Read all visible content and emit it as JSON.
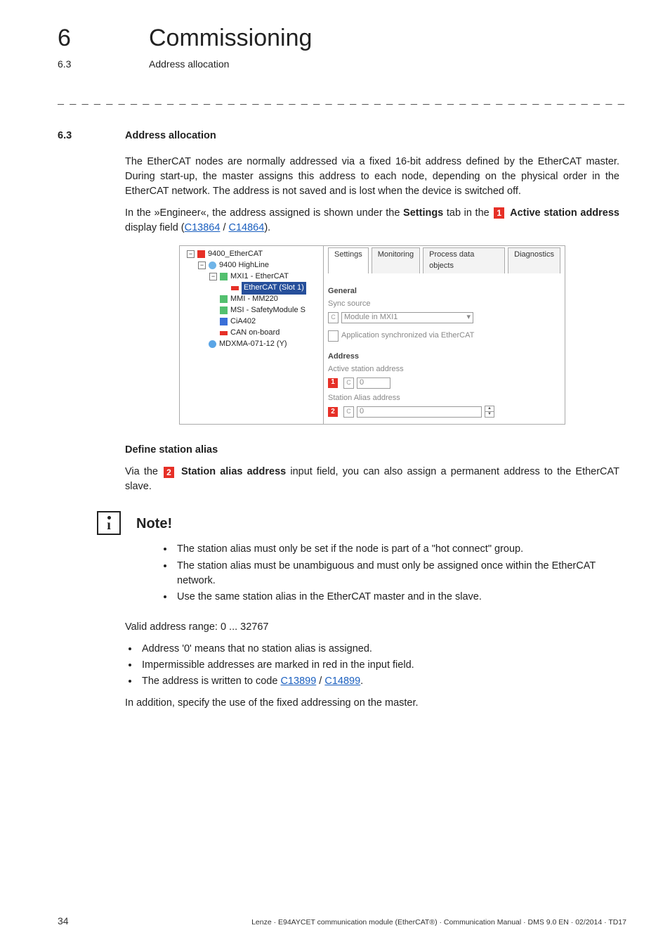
{
  "header": {
    "chapter_number": "6",
    "chapter_title": "Commissioning",
    "section_number": "6.3",
    "section_title_small": "Address allocation"
  },
  "ruler": "_ _ _ _ _ _ _ _ _ _ _ _ _ _ _ _ _ _ _ _ _ _ _ _ _ _ _ _ _ _ _ _ _ _ _ _ _ _ _ _ _ _ _ _ _ _ _ _ _ _ _ _ _ _ _ _ _ _ _ _ _ _ _ _",
  "section": {
    "number": "6.3",
    "title": "Address allocation"
  },
  "para1": "The EtherCAT nodes are normally addressed via a fixed 16-bit address defined by the EtherCAT master. During start-up, the master assigns this address to each node, depending on the physical order in the EtherCAT network. The address is not saved and is lost when the device is switched off.",
  "para2": {
    "a": "In the »Engineer«, the address assigned is shown under the ",
    "b_bold": "Settings",
    "c": " tab in the ",
    "marker": "1",
    "d_bold": " Active station address",
    "e": " display field (",
    "link1": "C13864",
    "sep": " / ",
    "link2": "C14864",
    "f": ")."
  },
  "figure": {
    "tree": [
      {
        "indent": 1,
        "exp": "−",
        "iconClass": "dev",
        "label": "9400_EtherCAT",
        "sel": false
      },
      {
        "indent": 2,
        "exp": "−",
        "iconClass": "sphere",
        "label": "9400 HighLine",
        "sel": false
      },
      {
        "indent": 3,
        "exp": "−",
        "iconClass": "chip",
        "label": "MXI1 - EtherCAT",
        "sel": false
      },
      {
        "indent": 4,
        "exp": "",
        "iconClass": "bar",
        "label": "EtherCAT (Slot 1)",
        "sel": true
      },
      {
        "indent": 3,
        "exp": "",
        "iconClass": "chip",
        "label": "MMI - MM220",
        "sel": false
      },
      {
        "indent": 3,
        "exp": "",
        "iconClass": "chip",
        "label": "MSI - SafetyModule S",
        "sel": false
      },
      {
        "indent": 3,
        "exp": "",
        "iconClass": "block",
        "label": "CiA402",
        "sel": false
      },
      {
        "indent": 3,
        "exp": "",
        "iconClass": "bar",
        "label": "CAN on-board",
        "sel": false
      },
      {
        "indent": 2,
        "exp": "",
        "iconClass": "blue",
        "label": "MDXMA-071-12 (Y)",
        "sel": false
      }
    ],
    "tabs": [
      "Settings",
      "Monitoring",
      "Process data objects",
      "Diagnostics"
    ],
    "active_tab": 0,
    "group_general": "General",
    "label_sync": "Sync source",
    "sync_value": "Module in MXI1",
    "checkbox_label": "Application synchronized via EtherCAT",
    "group_address": "Address",
    "label_active": "Active station address",
    "active_value": "0",
    "label_alias": "Station Alias address",
    "alias_value": "0",
    "marker1": "1",
    "marker2": "2",
    "c_letter": "C"
  },
  "define_alias_heading": "Define station alias",
  "para3": {
    "a": "Via the ",
    "marker": "2",
    "b_bold": " Station alias address",
    "c": " input field, you can also assign a permanent address to the EtherCAT slave."
  },
  "note": {
    "title": "Note!",
    "items": [
      "The station alias must only be set if the node is part of a \"hot connect\" group.",
      "The station alias must be unambiguous and must only be assigned once within the EtherCAT network.",
      "Use the same station alias in the EtherCAT master and in the slave."
    ]
  },
  "valid_range": "Valid address range: 0 ... 32767",
  "bullets": {
    "b1": "Address '0' means that no station alias is assigned.",
    "b2": "Impermissible addresses are marked in red in the input field.",
    "b3_a": "The address is written to code ",
    "b3_link1": "C13899",
    "b3_sep": " / ",
    "b3_link2": "C14899",
    "b3_b": "."
  },
  "para4": "In addition, specify the use of the fixed addressing on the master.",
  "footer": {
    "page": "34",
    "doc": "Lenze · E94AYCET communication module (EtherCAT®) · Communication Manual · DMS 9.0 EN · 02/2014 · TD17"
  }
}
